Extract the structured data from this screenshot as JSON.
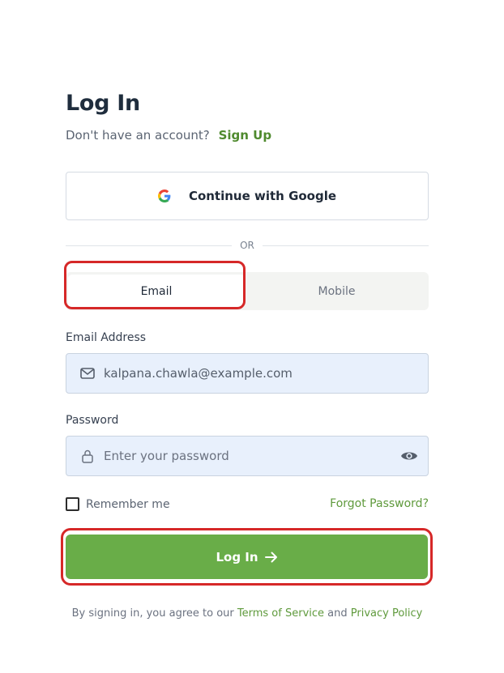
{
  "header": {
    "title": "Log In",
    "signup_prompt": "Don't have an account?",
    "signup_link": "Sign Up"
  },
  "google": {
    "label": "Continue with Google",
    "icon": "google-icon"
  },
  "divider": {
    "text": "OR"
  },
  "tabs": [
    {
      "label": "Email",
      "active": true
    },
    {
      "label": "Mobile",
      "active": false
    }
  ],
  "email": {
    "label": "Email Address",
    "value": "kalpana.chawla@example.com",
    "icon": "mail-icon"
  },
  "password": {
    "label": "Password",
    "placeholder": "Enter your password",
    "icon": "lock-icon",
    "toggle_icon": "eye-icon"
  },
  "remember": {
    "label": "Remember me",
    "checked": false
  },
  "forgot": {
    "label": "Forgot Password?"
  },
  "submit": {
    "label": "Log In",
    "icon": "arrow-right-icon"
  },
  "terms": {
    "prefix": "By signing in, you agree to our",
    "terms_link": "Terms of Service",
    "and": "and",
    "privacy_link": "Privacy Policy"
  },
  "colors": {
    "accent": "#69ad48",
    "link": "#5f9a3c",
    "highlight": "#d62828",
    "input_bg": "#e8f0fc"
  }
}
